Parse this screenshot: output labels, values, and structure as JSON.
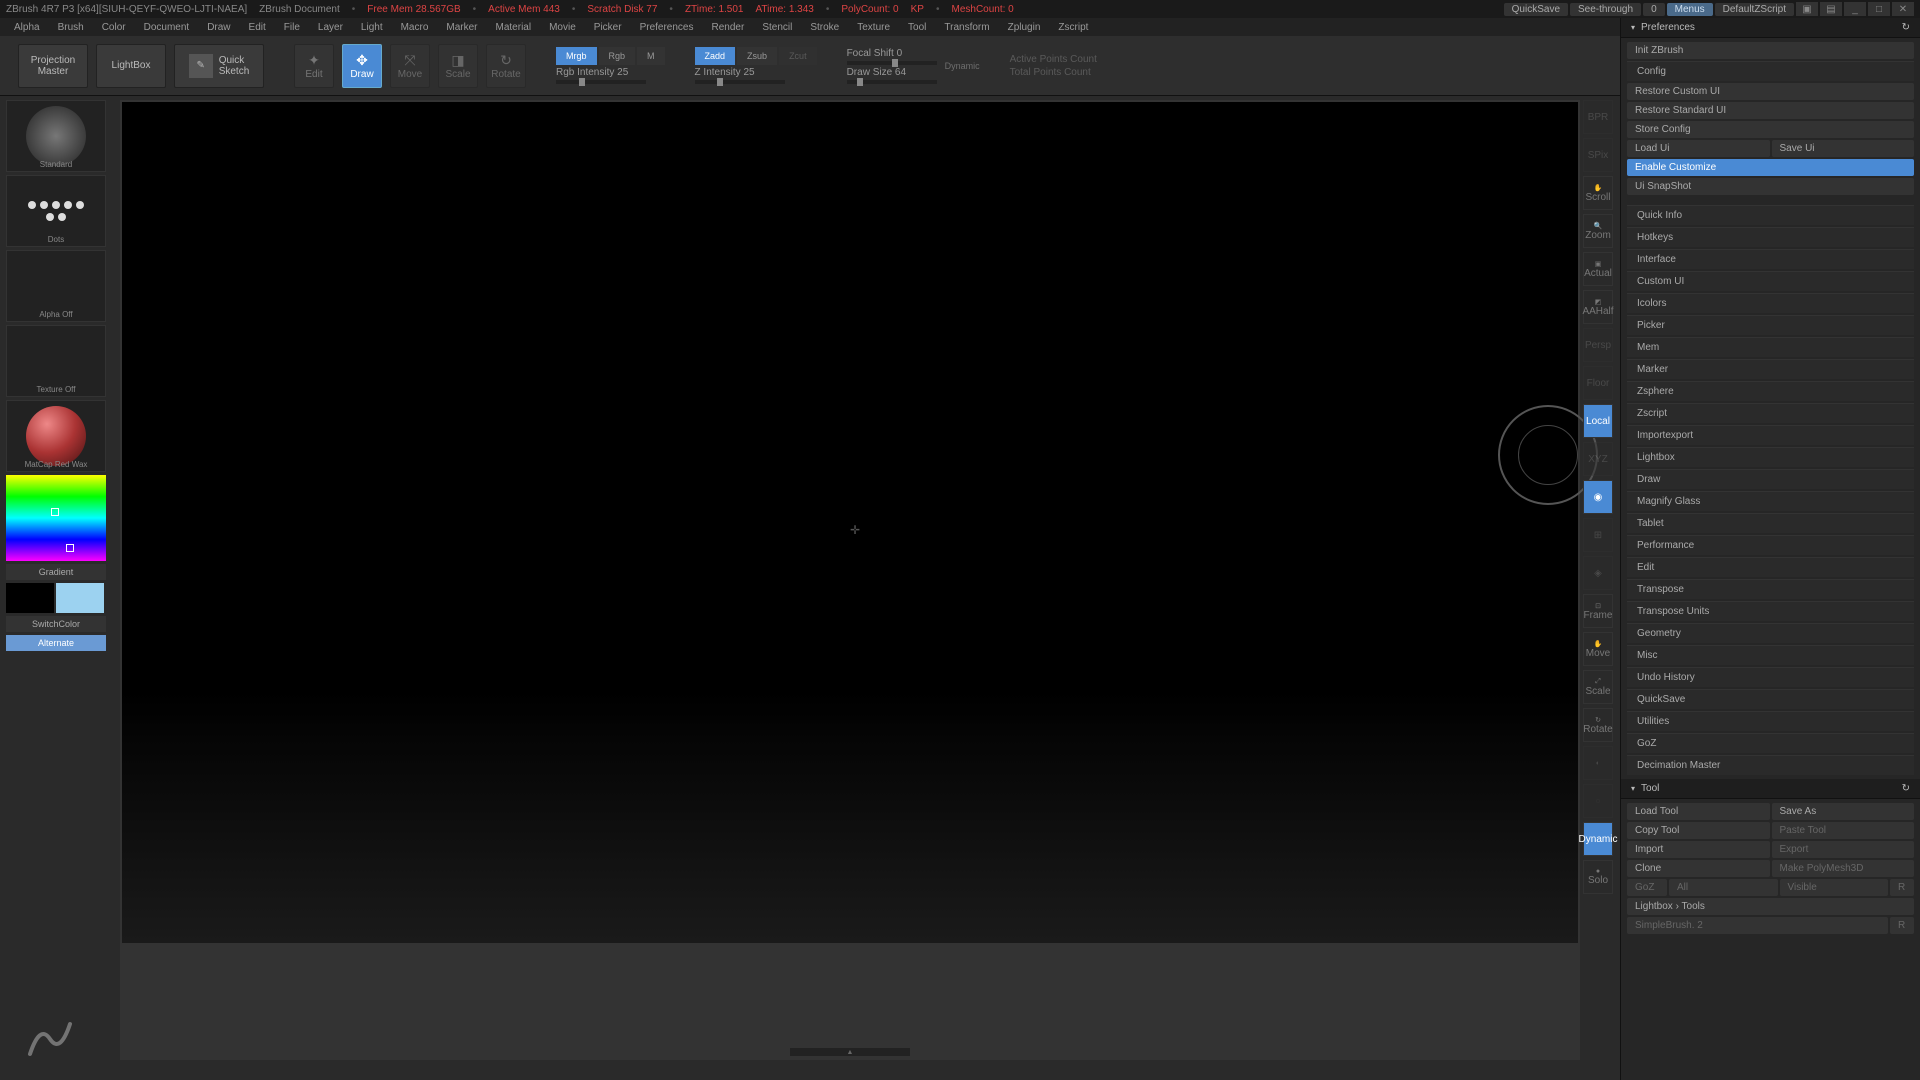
{
  "title": {
    "app": "ZBrush 4R7 P3 [x64][SIUH-QEYF-QWEO-LJTI-NAEA]",
    "doc": "ZBrush Document",
    "freemem": "Free Mem 28.567GB",
    "activemem": "Active Mem 443",
    "scratch": "Scratch Disk 77",
    "ztime": "ZTime: 1.501",
    "atime": "ATime: 1.343",
    "polycount": "PolyCount: 0",
    "kp": "KP",
    "meshcount": "MeshCount: 0",
    "quicksave": "QuickSave",
    "seethrough": "See-through",
    "seethrough_val": "0",
    "menus": "Menus",
    "script": "DefaultZScript"
  },
  "menu": [
    "Alpha",
    "Brush",
    "Color",
    "Document",
    "Draw",
    "Edit",
    "File",
    "Layer",
    "Light",
    "Macro",
    "Marker",
    "Material",
    "Movie",
    "Picker",
    "Preferences",
    "Render",
    "Stencil",
    "Stroke",
    "Texture",
    "Tool",
    "Transform",
    "Zplugin",
    "Zscript"
  ],
  "shelf": {
    "projection": "Projection\nMaster",
    "lightbox": "LightBox",
    "quicksketch": "Quick\nSketch",
    "edit": "Edit",
    "draw": "Draw",
    "move": "Move",
    "scale": "Scale",
    "rotate": "Rotate",
    "mrgb": "Mrgb",
    "rgb": "Rgb",
    "m": "M",
    "zadd": "Zadd",
    "zsub": "Zsub",
    "zcut": "Zcut",
    "rgb_int": "Rgb Intensity 25",
    "z_int": "Z Intensity 25",
    "focal": "Focal Shift 0",
    "drawsize": "Draw Size 64",
    "dynamic": "Dynamic",
    "active_pts": "Active Points Count",
    "total_pts": "Total Points Count"
  },
  "left": {
    "brush": "Standard",
    "stroke": "Dots",
    "alpha": "Alpha Off",
    "texture": "Texture Off",
    "matcap": "MatCap Red Wax",
    "gradient": "Gradient",
    "switch": "SwitchColor",
    "alternate": "Alternate"
  },
  "dock": [
    "BPR",
    "SPix",
    "Scroll",
    "Zoom",
    "Actual",
    "AAHalf",
    "Persp",
    "Floor",
    "Local",
    "XYZ",
    "Frame",
    "Move",
    "Scale",
    "Rotate",
    "Dynamic",
    "Solo"
  ],
  "prefs": {
    "title": "Preferences",
    "init": "Init ZBrush",
    "config": "Config",
    "restore_c": "Restore Custom UI",
    "restore_s": "Restore Standard UI",
    "store": "Store Config",
    "load_ui": "Load Ui",
    "save_ui": "Save Ui",
    "enable": "Enable Customize",
    "snapshot": "Ui SnapShot",
    "cats": [
      "Quick Info",
      "Hotkeys",
      "Interface",
      "Custom UI",
      "Icolors",
      "Picker",
      "Mem",
      "Marker",
      "Zsphere",
      "Zscript",
      "Importexport",
      "Lightbox",
      "Draw",
      "Magnify Glass",
      "Tablet",
      "Performance",
      "Edit",
      "Transpose",
      "Transpose Units",
      "Geometry",
      "Misc",
      "Undo History",
      "QuickSave",
      "Utilities",
      "GoZ",
      "Decimation Master"
    ]
  },
  "tool": {
    "title": "Tool",
    "load": "Load Tool",
    "saveas": "Save As",
    "copy": "Copy Tool",
    "paste": "Paste Tool",
    "import": "Import",
    "export": "Export",
    "clone": "Clone",
    "makepoly": "Make PolyMesh3D",
    "all": "All",
    "visible": "Visible",
    "r": "R",
    "lightbox_tools": "Lightbox › Tools",
    "simplebrush": "SimpleBrush. 2"
  }
}
